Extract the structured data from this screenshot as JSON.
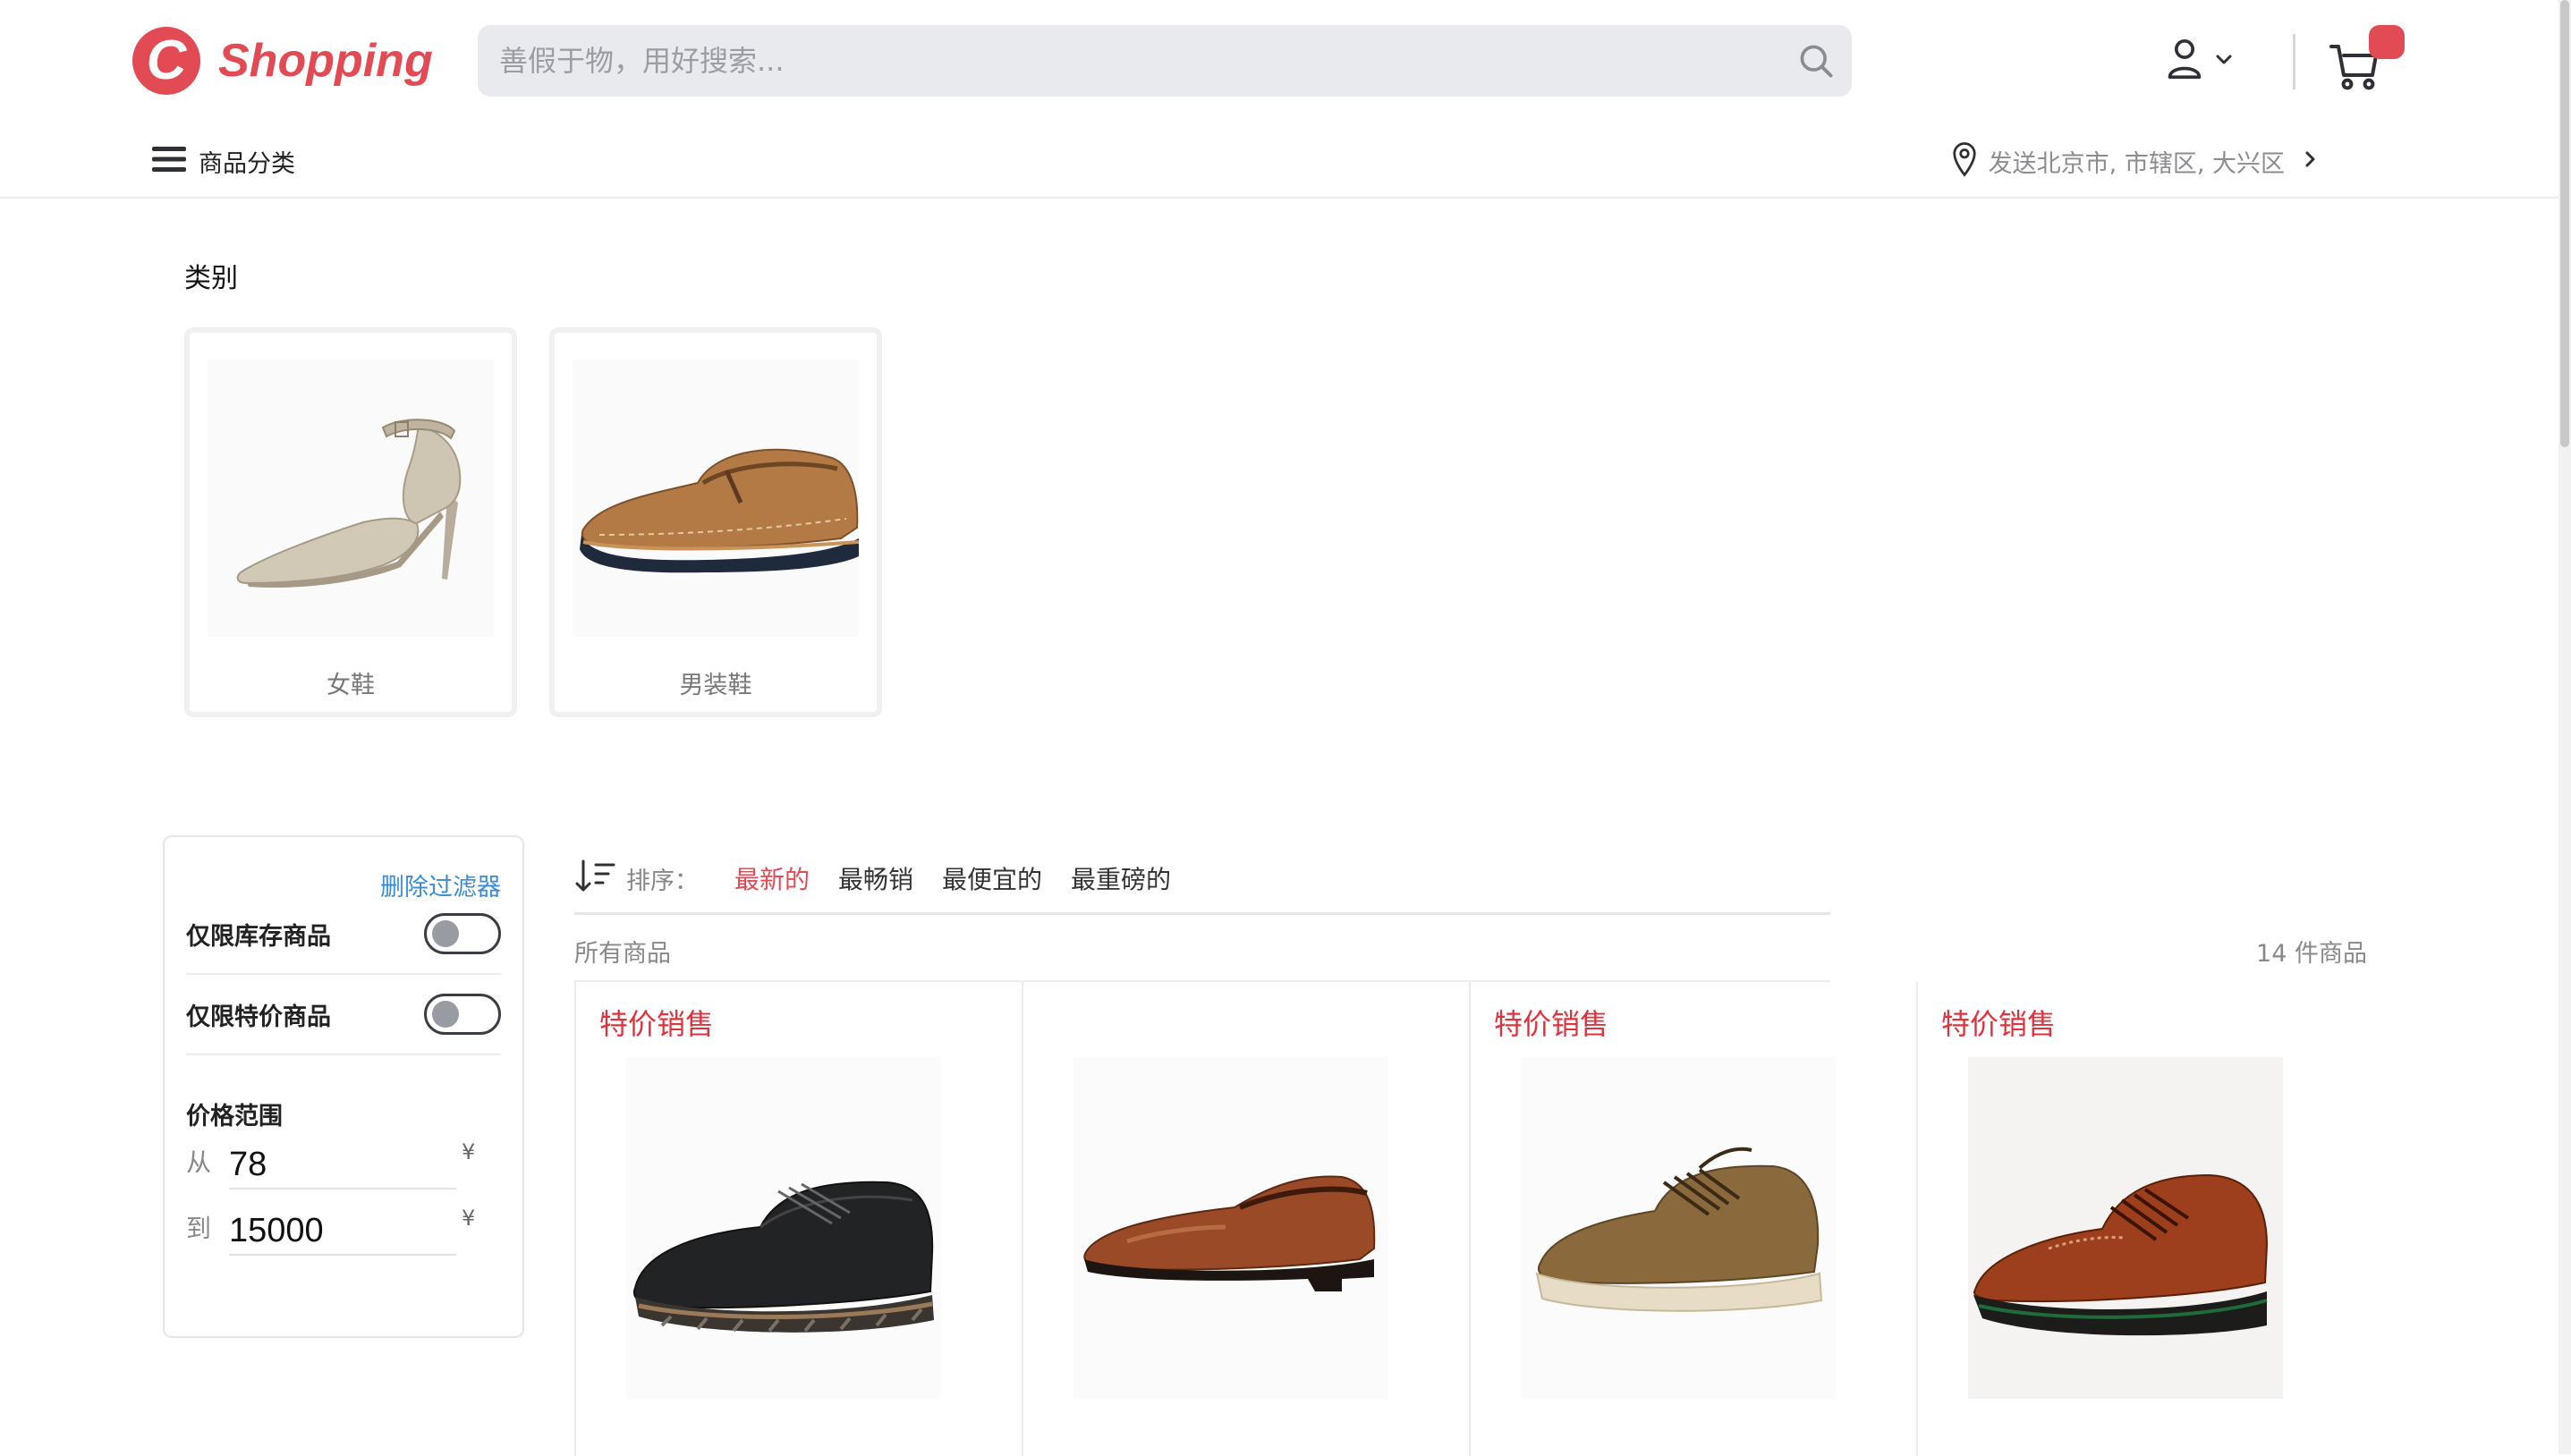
{
  "header": {
    "logo_letter": "C",
    "logo_text": "Shopping",
    "search_placeholder": "善假于物，用好搜索...",
    "menu_label": "商品分类",
    "location_label": "发送北京市, 市辖区, 大兴区"
  },
  "categories": {
    "title": "类别",
    "items": [
      {
        "name": "女鞋",
        "icon": "womens-heel-image"
      },
      {
        "name": "男装鞋",
        "icon": "mens-loafer-image"
      }
    ]
  },
  "filters": {
    "clear_label": "删除过滤器",
    "in_stock_label": "仅限库存商品",
    "in_stock_on": false,
    "special_label": "仅限特价商品",
    "special_on": false,
    "price_title": "价格范围",
    "from_label": "从",
    "from_value": "78",
    "to_label": "到",
    "to_value": "15000",
    "currency": "¥"
  },
  "sort": {
    "label": "排序：",
    "options": [
      "最新的",
      "最畅销",
      "最便宜的",
      "最重磅的"
    ],
    "active_index": 0
  },
  "listing": {
    "all_label": "所有商品",
    "count_label": "14 件商品"
  },
  "products": [
    {
      "tag": "特价销售",
      "image": "black-wingtip-shoe"
    },
    {
      "tag": "",
      "image": "brown-loafer"
    },
    {
      "tag": "特价销售",
      "image": "suede-oxford-shoe"
    },
    {
      "tag": "特价销售",
      "image": "brown-brogue-shoe"
    }
  ],
  "colors": {
    "brand": "#e24a54",
    "link": "#3a8bd6",
    "sale": "#e0323c"
  }
}
